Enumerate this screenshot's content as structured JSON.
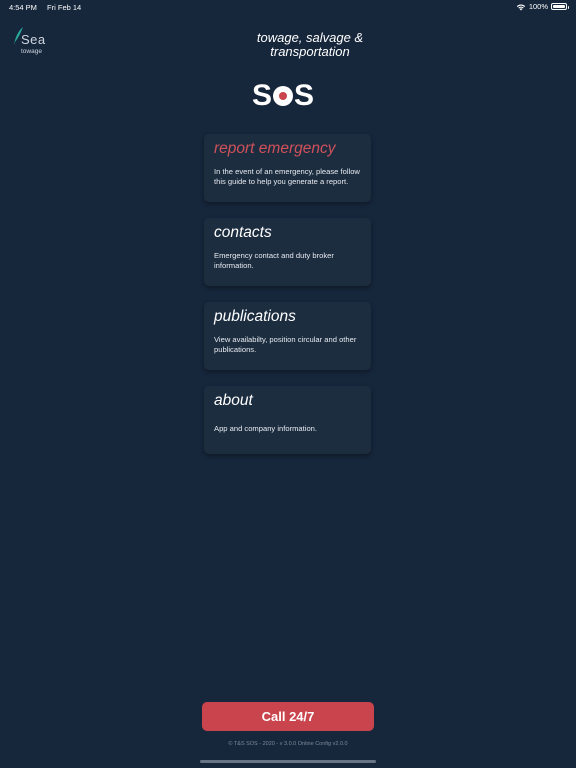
{
  "status_bar": {
    "time": "4:54 PM",
    "date": "Fri Feb 14",
    "battery": "100%"
  },
  "logo": {
    "text": "Sea",
    "subtext": "towage"
  },
  "header": {
    "tagline_line1": "towage, salvage &",
    "tagline_line2": "transportation",
    "sos_left": "S",
    "sos_right": "S"
  },
  "menu": [
    {
      "title": "report emergency",
      "description": "In the event of an emergency, please follow this guide to help you generate a report."
    },
    {
      "title": "contacts",
      "description": "Emergency contact and duty broker information."
    },
    {
      "title": "publications",
      "description": "View availabilty, position circular and other publications."
    },
    {
      "title": "about",
      "description": "App and company information."
    }
  ],
  "call_button": {
    "label": "Call 24/7"
  },
  "footer": {
    "text": "© T&S SOS - 2020 - v 3.0.0 Online Config v2.0.0"
  },
  "colors": {
    "background": "#16263b",
    "card": "#1d2d40",
    "accent": "#c9444d"
  }
}
